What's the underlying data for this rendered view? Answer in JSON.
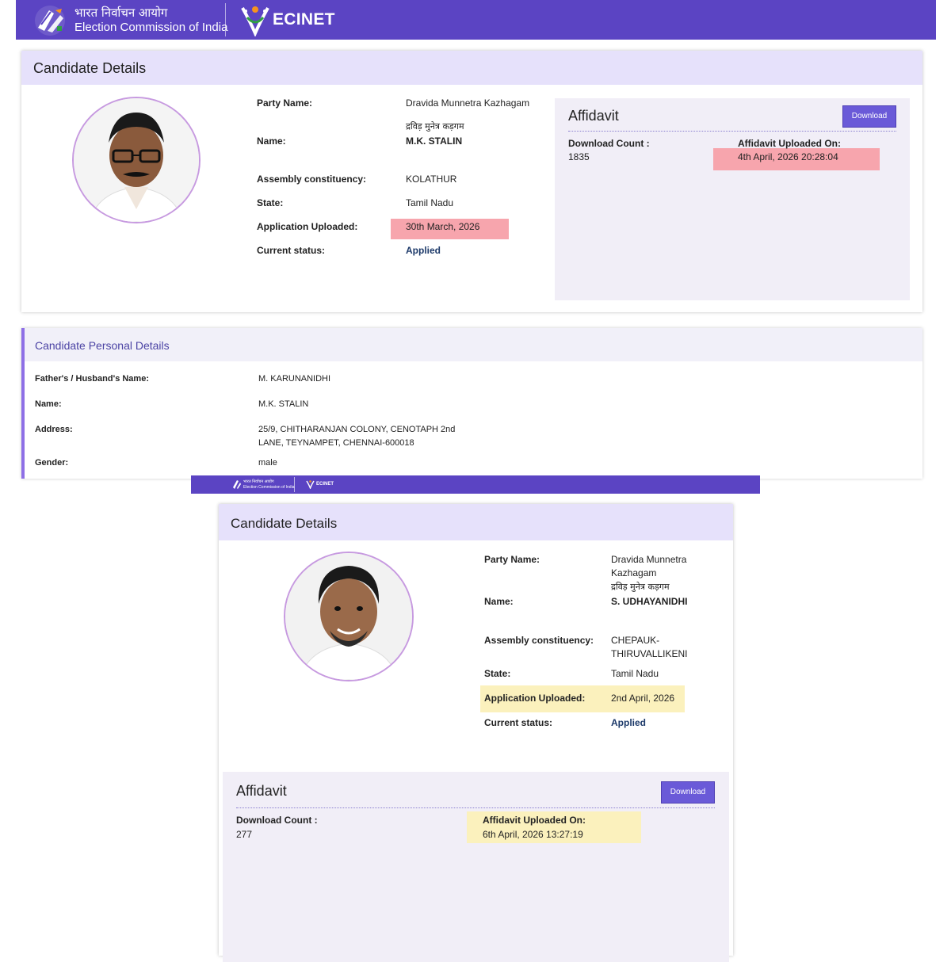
{
  "header": {
    "hindi_title": "भारत निर्वाचन आयोग",
    "english_title": "Election Commission of India",
    "app_name": "ECINET"
  },
  "card1": {
    "title": "Candidate Details",
    "fields": {
      "party_label": "Party Name:",
      "party_value": "Dravida Munnetra Kazhagam",
      "party_hindi": "द्रविड़ मुनेत्र कड़गम",
      "name_label": "Name:",
      "name_value": "M.K. STALIN",
      "ac_label": "Assembly constituency:",
      "ac_value": "KOLATHUR",
      "state_label": "State:",
      "state_value": "Tamil Nadu",
      "app_label": "Application Uploaded:",
      "app_value": "30th March, 2026",
      "status_label": "Current status:",
      "status_value": "Applied"
    },
    "affidavit": {
      "title": "Affidavit",
      "download_label": "Download",
      "count_label": "Download Count :",
      "count_value": "1835",
      "uploaded_label": "Affidavit Uploaded On:",
      "uploaded_value": "4th April, 2026 20:28:04"
    }
  },
  "personal": {
    "title": "Candidate Personal Details",
    "father_label": "Father's / Husband's Name:",
    "father_value": "M. KARUNANIDHI",
    "name_label": "Name:",
    "name_value": "M.K. STALIN",
    "address_label": "Address:",
    "address_line1": "25/9, CHITHARANJAN COLONY, CENOTAPH 2nd",
    "address_line2": "LANE, TEYNAMPET, CHENNAI-600018",
    "gender_label": "Gender:",
    "gender_value": "male"
  },
  "small_header": {
    "hindi_title": "भारत निर्वाचन आयोग",
    "english_title": "Election Commission of India",
    "app_name": "ECINET"
  },
  "card2": {
    "title": "Candidate Details",
    "fields": {
      "party_label": "Party Name:",
      "party_value_line1": "Dravida Munnetra",
      "party_value_line2": "Kazhagam",
      "party_hindi": "द्रविड़ मुनेत्र कड़गम",
      "name_label": "Name:",
      "name_value": "S. UDHAYANIDHI",
      "ac_label": "Assembly constituency:",
      "ac_value_line1": "CHEPAUK-",
      "ac_value_line2": "THIRUVALLIKENI",
      "state_label": "State:",
      "state_value": "Tamil Nadu",
      "app_label": "Application Uploaded:",
      "app_value": "2nd April, 2026",
      "status_label": "Current status:",
      "status_value": "Applied"
    },
    "affidavit": {
      "title": "Affidavit",
      "download_label": "Download",
      "count_label": "Download Count :",
      "count_value": "277",
      "uploaded_label": "Affidavit Uploaded On:",
      "uploaded_value": "6th April, 2026 13:27:19"
    }
  },
  "colors": {
    "header_purple": "#5b44c3",
    "card_head": "#e6e1fb",
    "highlight_red": "#f7a5ad",
    "highlight_yellow": "#fbf1bd",
    "button": "#6a5ad8"
  }
}
